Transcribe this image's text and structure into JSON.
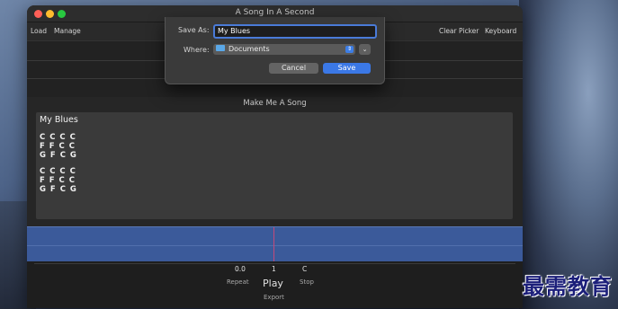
{
  "window": {
    "title": "A Song In A Second"
  },
  "toolbar": {
    "load_label": "Load",
    "manage_label": "Manage",
    "clear_picker_label": "Clear Picker",
    "keyboard_label": "Keyboard"
  },
  "dialog": {
    "save_as_label": "Save As:",
    "save_as_value": "My Blues",
    "where_label": "Where:",
    "where_value": "Documents",
    "cancel_label": "Cancel",
    "save_label": "Save"
  },
  "main": {
    "heading": "Make Me A Song",
    "song_title": "My Blues",
    "chord_lines": [
      "C C C C",
      "F F C C",
      "G F C G",
      "C C C C",
      "F F C C",
      "G F C G"
    ]
  },
  "transport": {
    "repeat_value": "0.0",
    "play_value": "1",
    "stop_value": "C",
    "repeat_label": "Repeat",
    "play_label": "Play",
    "stop_label": "Stop",
    "export_label": "Export"
  },
  "watermark": {
    "text": "最需教育"
  },
  "colors": {
    "accent": "#3b78e6",
    "playhead": "#c34a7a",
    "wave": "#3b5a9a"
  }
}
